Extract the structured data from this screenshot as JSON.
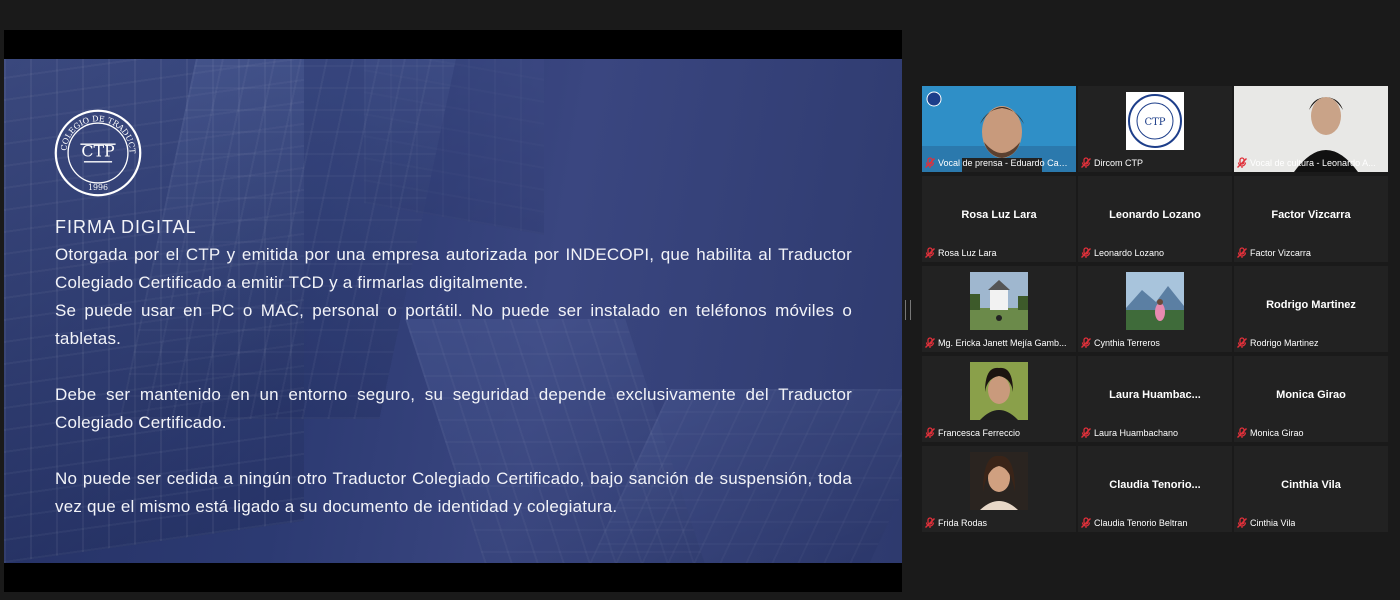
{
  "slide": {
    "logo_text": "COLEGIO DE TRADUCTORES DEL PERÚ",
    "logo_initials": "CTP",
    "logo_year": "1996",
    "title": "FIRMA DIGITAL",
    "paragraphs": [
      "Otorgada por el CTP y emitida por una empresa autorizada por INDECOPI, que habilita al Traductor Colegiado Certificado a emitir TCD y a firmarlas digitalmente.",
      "Se puede usar en PC o MAC, personal o portátil. No puede ser instalado en teléfonos móviles o tabletas.",
      "Debe ser mantenido en un entorno seguro, su seguridad depende exclusivamente del Traductor Colegiado Certificado.",
      "No puede ser cedida a ningún otro Traductor Colegiado Certificado, bajo sanción de suspensión, toda vez que el mismo está ligado a su documento de identidad y colegiatura."
    ]
  },
  "participants": [
    {
      "label": "Vocal de prensa - Eduardo Castil...",
      "type": "video-man",
      "active": true
    },
    {
      "label": "Dircom CTP",
      "type": "logo"
    },
    {
      "label": "Vocal de cultura - Leonardo A...",
      "type": "video-man2"
    },
    {
      "name": "Rosa Luz Lara",
      "label": "Rosa Luz Lara"
    },
    {
      "name": "Leonardo Lozano",
      "label": "Leonardo Lozano"
    },
    {
      "name": "Factor Vizcarra",
      "label": "Factor Vizcarra"
    },
    {
      "label": "Mg. Ericka Janett Mejía Gamb...",
      "type": "photo-church"
    },
    {
      "label": "Cynthia Terreros",
      "type": "photo-mountain"
    },
    {
      "name": "Rodrigo Martinez",
      "label": "Rodrigo Martinez"
    },
    {
      "label": "Francesca Ferreccio",
      "type": "photo-woman1"
    },
    {
      "name": "Laura  Huambac...",
      "label": "Laura Huambachano"
    },
    {
      "name": "Monica Girao",
      "label": "Monica Girao"
    },
    {
      "label": "Frida Rodas",
      "type": "photo-woman2"
    },
    {
      "name": "Claudia  Tenorio...",
      "label": "Claudia Tenorio Beltran"
    },
    {
      "name": "Cinthia Vila",
      "label": "Cinthia Vila"
    }
  ],
  "colors": {
    "active_border": "#e7e24a",
    "muted_mic": "#e0303a",
    "tile_bg": "#222222"
  },
  "icons": {
    "mic": "muted-mic-icon"
  }
}
